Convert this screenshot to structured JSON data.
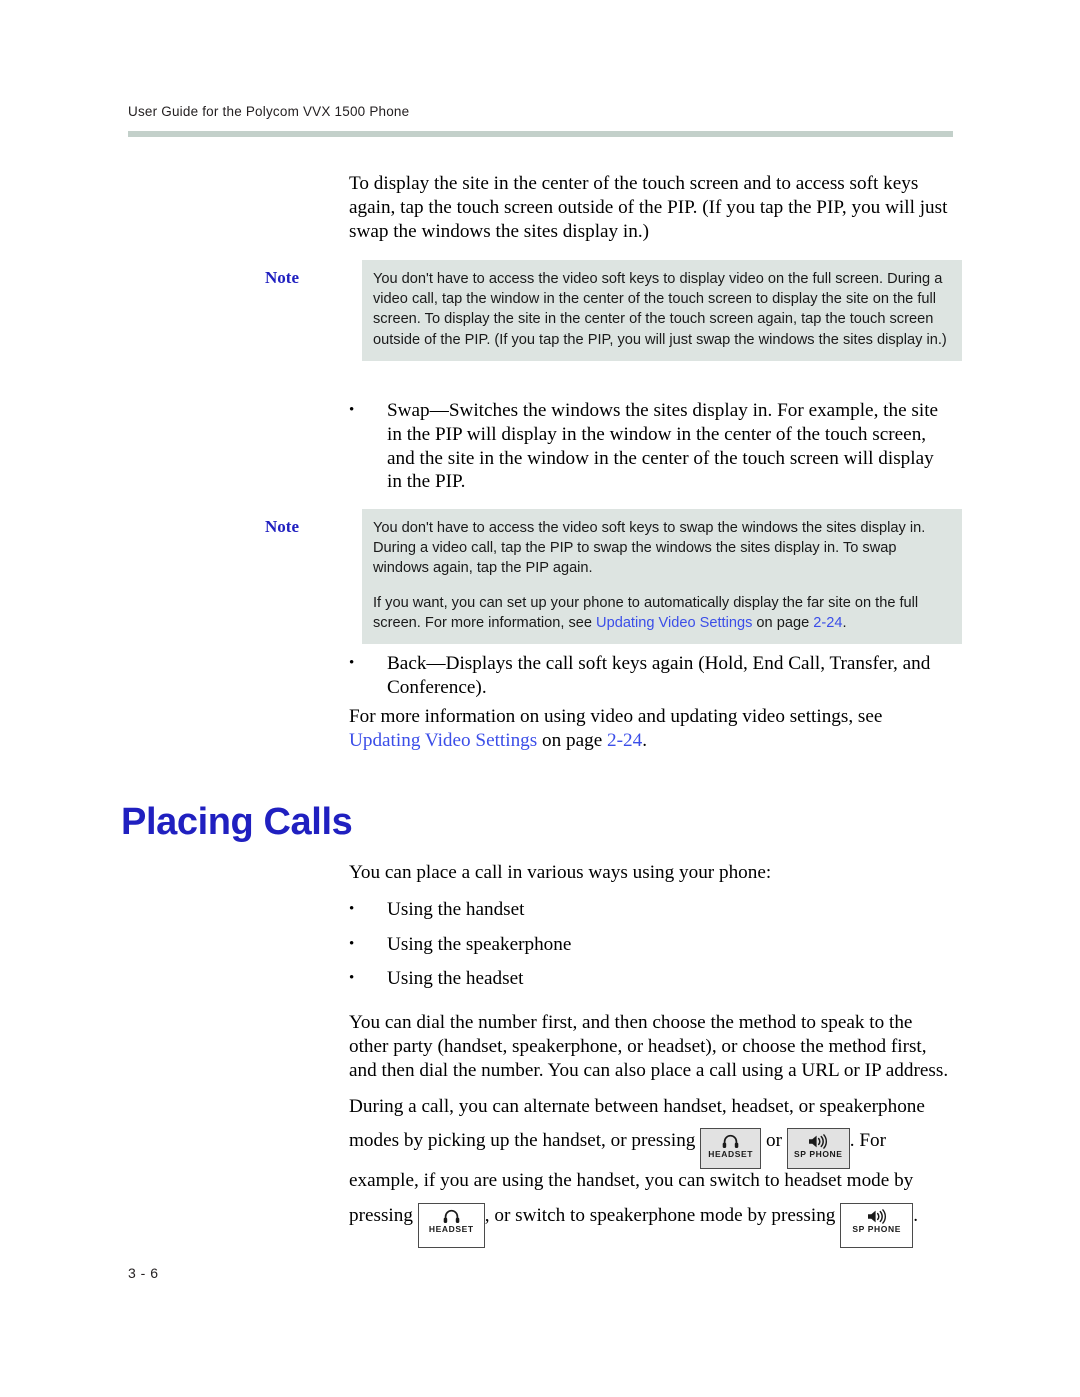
{
  "header": {
    "running_header": "User Guide for the Polycom VVX 1500 Phone"
  },
  "intro_paragraph": "To display the site in the center of the touch screen and to access soft keys again, tap the touch screen outside of the PIP. (If you tap the PIP, you will just swap the windows the sites display in.)",
  "note_one": {
    "label": "Note",
    "text": "You don't have to access the video soft keys to display video on the full screen. During a video call, tap the window in the center of the touch screen to display the site on the full screen. To display the site in the center of the touch screen again, tap the touch screen outside of the PIP. (If you tap the PIP, you will just swap the windows the sites display in.)"
  },
  "swap_bullet": {
    "marker": "•",
    "text": "Swap—Switches the windows the sites display in. For example, the site in the PIP will display in the window in the center of the touch screen, and the site in the window in the center of the touch screen will display in the PIP."
  },
  "note_two": {
    "label": "Note",
    "paragraph_1": "You don't have to access the video soft keys to swap the windows the sites display in. During a video call, tap the PIP to swap the windows the sites display in. To swap windows again, tap the PIP again.",
    "paragraph_2_before": "If you want, you can set up your phone to automatically display the far site on the full screen. For more information, see ",
    "paragraph_2_link": "Updating Video Settings",
    "paragraph_2_middle": " on page ",
    "paragraph_2_page": "2-24",
    "paragraph_2_after": "."
  },
  "back_bullet": {
    "marker": "•",
    "text": "Back—Displays the call soft keys again (Hold, End Call, Transfer, and Conference)."
  },
  "more_info": {
    "before": "For more information on using video and updating video settings, see ",
    "link": "Updating Video Settings",
    "middle": " on page ",
    "page": "2-24",
    "after": "."
  },
  "section": {
    "heading": "Placing Calls",
    "lead_in": "You can place a call in various ways using your phone:",
    "bullets": [
      {
        "marker": "•",
        "text": "Using the handset"
      },
      {
        "marker": "•",
        "text": "Using the speakerphone"
      },
      {
        "marker": "•",
        "text": "Using the headset"
      }
    ],
    "paragraph_dial": "You can dial the number first, and then choose the method to speak to the other party (handset, speakerphone, or headset), or choose the method first, and then dial the number. You can also place a call using a URL or IP address.",
    "paragraph_alternate_line1": "During a call, you can alternate between handset, headset, or speakerphone",
    "paragraph_alternate_line2_a": "modes by picking up the handset, or pressing ",
    "paragraph_alternate_line2_or": " or ",
    "paragraph_alternate_line2_b": ". For",
    "paragraph_alternate_line3": "example, if you are using the handset, you can switch to headset mode by",
    "paragraph_alternate_line4_a": "pressing ",
    "paragraph_alternate_line4_b": ", or switch to speakerphone mode by pressing ",
    "paragraph_alternate_line4_c": "."
  },
  "keys": {
    "headset_label": "HEADSET",
    "sp_phone_label": "SP PHONE"
  },
  "footer": {
    "page_number": "3 - 6"
  },
  "colors": {
    "heading_blue": "#2020c0",
    "link_blue": "#3b4ee8",
    "note_background": "#dde4e1",
    "rule": "#c3d0ca"
  }
}
